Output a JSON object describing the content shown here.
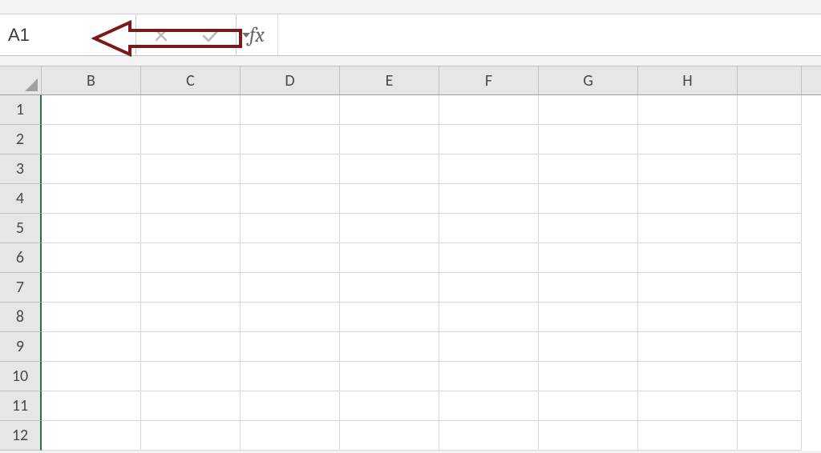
{
  "formula_bar": {
    "name_box_value": "A1",
    "formula_value": "",
    "fx_label": "fx"
  },
  "columns": [
    "B",
    "C",
    "D",
    "E",
    "F",
    "G",
    "H"
  ],
  "rows": [
    "1",
    "2",
    "3",
    "4",
    "5",
    "6",
    "7",
    "8",
    "9",
    "10",
    "11",
    "12"
  ],
  "cells": {}
}
